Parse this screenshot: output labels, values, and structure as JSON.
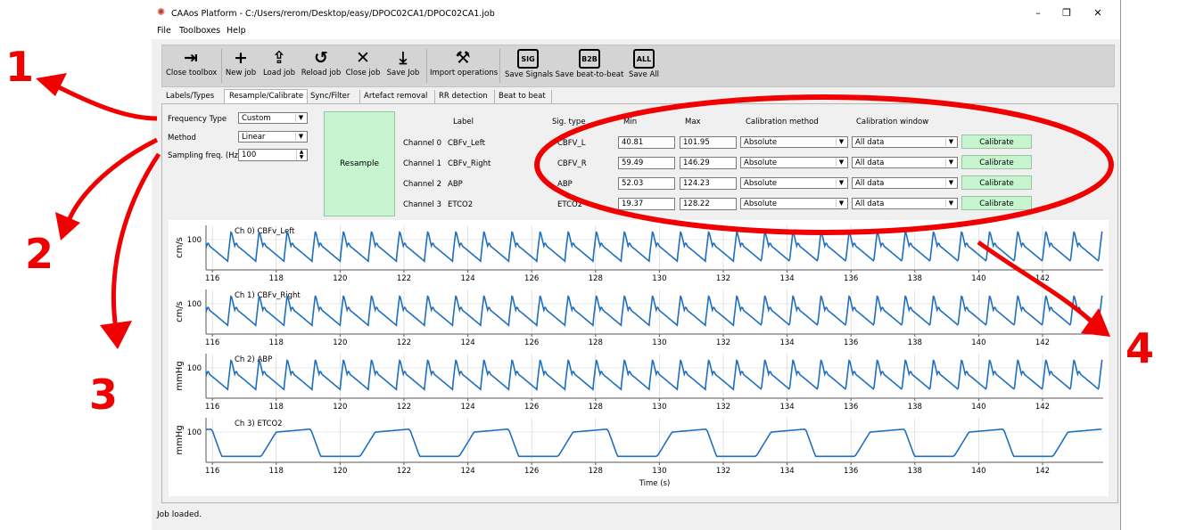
{
  "window": {
    "title": "CAAos Platform - C:/Users/rerom/Desktop/easy/DPOC02CA1/DPOC02CA1.job",
    "controls": [
      "–",
      "❐",
      "✕"
    ]
  },
  "menu": [
    "File",
    "Toolboxes",
    "Help"
  ],
  "toolbar": [
    {
      "label": "Close toolbox",
      "icon": "exit-icon",
      "glyph": "⇥"
    },
    {
      "label": "New job",
      "icon": "plus-icon",
      "glyph": "+"
    },
    {
      "label": "Load job",
      "icon": "upload-icon",
      "glyph": "⇪"
    },
    {
      "label": "Reload job",
      "icon": "reload-icon",
      "glyph": "↺"
    },
    {
      "label": "Close job",
      "icon": "close-icon",
      "glyph": "✕"
    },
    {
      "label": "Save Job",
      "icon": "download-icon",
      "glyph": "⤓"
    },
    {
      "label": "Import operations",
      "icon": "tools-icon",
      "glyph": "⚒"
    },
    {
      "label": "Save Signals",
      "icon": "save-sig-icon",
      "glyph": "SIG"
    },
    {
      "label": "Save beat-to-beat",
      "icon": "save-b2b-icon",
      "glyph": "B2B"
    },
    {
      "label": "Save All",
      "icon": "save-all-icon",
      "glyph": "ALL"
    }
  ],
  "tabs": [
    "Labels/Types",
    "Resample/Calibrate",
    "Sync/Filter",
    "Artefact removal",
    "RR detection",
    "Beat to beat"
  ],
  "active_tab": "Resample/Calibrate",
  "resample": {
    "frequency_type_label": "Frequency Type",
    "frequency_type_value": "Custom",
    "method_label": "Method",
    "method_value": "Linear",
    "sampling_label": "Sampling freq. (Hz)",
    "sampling_value": "100",
    "button": "Resample"
  },
  "calibration": {
    "headers": {
      "label": "Label",
      "sig_type": "Sig. type",
      "min": "Min",
      "max": "Max",
      "method": "Calibration method",
      "window": "Calibration window"
    },
    "button_label": "Calibrate",
    "channels": [
      {
        "channel": "Channel 0",
        "label": "CBFv_Left",
        "sig_type": "CBFV_L",
        "min": "40.81",
        "max": "101.95",
        "method": "Absolute",
        "window": "All data"
      },
      {
        "channel": "Channel 1",
        "label": "CBFv_Right",
        "sig_type": "CBFV_R",
        "min": "59.49",
        "max": "146.29",
        "method": "Absolute",
        "window": "All data"
      },
      {
        "channel": "Channel 2",
        "label": "ABP",
        "sig_type": "ABP",
        "min": "52.03",
        "max": "124.23",
        "method": "Absolute",
        "window": "All data"
      },
      {
        "channel": "Channel 3",
        "label": "ETCO2",
        "sig_type": "ETCO2",
        "min": "19.37",
        "max": "128.22",
        "method": "Absolute",
        "window": "All data"
      }
    ]
  },
  "status": "Job loaded.",
  "annotations": [
    "1",
    "2",
    "3",
    "4"
  ],
  "colors": {
    "annotation": "#f00000",
    "trace": "#1f6fbf",
    "calibrate_btn": "#c6f5cf"
  },
  "chart_data": [
    {
      "type": "line",
      "title": "Ch 0) CBFv_Left",
      "ylabel": "cm/s",
      "xlim": [
        115.8,
        143.9
      ],
      "yticks": [
        100
      ],
      "xticks": [
        116,
        118,
        120,
        122,
        124,
        126,
        128,
        130,
        132,
        134,
        136,
        138,
        140,
        142
      ],
      "waveform": "pulsatile",
      "beat_period_s": 0.88,
      "y_tick_value": 100
    },
    {
      "type": "line",
      "title": "Ch 1) CBFv_Right",
      "ylabel": "cm/s",
      "xlim": [
        115.8,
        143.9
      ],
      "yticks": [
        100
      ],
      "xticks": [
        116,
        118,
        120,
        122,
        124,
        126,
        128,
        130,
        132,
        134,
        136,
        138,
        140,
        142
      ],
      "waveform": "pulsatile",
      "beat_period_s": 0.88,
      "y_tick_value": 100
    },
    {
      "type": "line",
      "title": "Ch 2) ABP",
      "ylabel": "mmHg",
      "xlim": [
        115.8,
        143.9
      ],
      "yticks": [
        100
      ],
      "xticks": [
        116,
        118,
        120,
        122,
        124,
        126,
        128,
        130,
        132,
        134,
        136,
        138,
        140,
        142
      ],
      "waveform": "pulsatile",
      "beat_period_s": 0.88,
      "y_tick_value": 100
    },
    {
      "type": "line",
      "title": "Ch 3) ETCO2",
      "ylabel": "mmHg",
      "xlabel": "Time (s)",
      "xlim": [
        115.8,
        143.9
      ],
      "yticks": [
        100
      ],
      "xticks": [
        116,
        118,
        120,
        122,
        124,
        126,
        128,
        130,
        132,
        134,
        136,
        138,
        140,
        142
      ],
      "waveform": "capnogram",
      "breath_period_s": 3.1,
      "y_tick_value": 100
    }
  ]
}
